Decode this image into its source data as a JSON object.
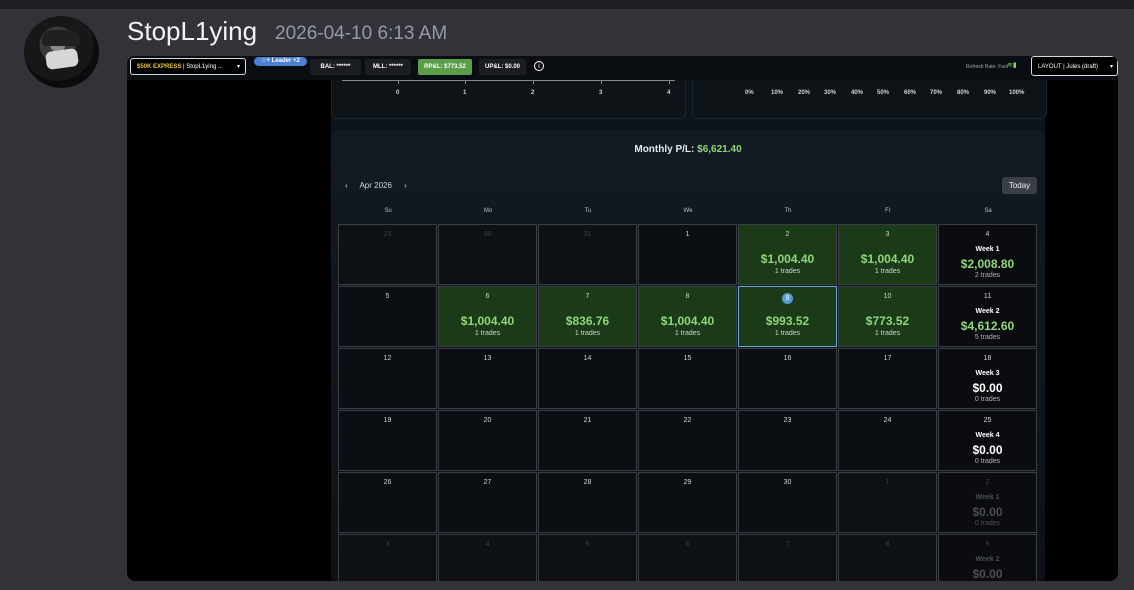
{
  "message": {
    "username": "StopL1ying",
    "timestamp": "2026-04-10 6:13 AM"
  },
  "toolbar": {
    "account_prefix": "$50K EXPRESS",
    "account_name": " | StopL1ying ...",
    "leader_badge": "☆+ Leader +2",
    "bal": "BAL: ******",
    "mll": "MLL: ******",
    "rpl": "RP&L: $773.52",
    "upl": "UP&L: $0.00",
    "info": "i",
    "refresh": "Refresh Rate: Fast",
    "layout": "LAYOUT | Jules (draft)"
  },
  "panels": {
    "left_ticks": [
      "0",
      "1",
      "2",
      "3",
      "4"
    ],
    "right_ticks": [
      "0%",
      "10%",
      "20%",
      "30%",
      "40%",
      "50%",
      "60%",
      "70%",
      "80%",
      "90%",
      "100%"
    ]
  },
  "calendar": {
    "title_label": "Monthly P/L: ",
    "title_value": "$6,621.40",
    "prev": "‹",
    "month": "Apr 2026",
    "next": "›",
    "today": "Today",
    "weekdays": [
      "Su",
      "Mo",
      "Tu",
      "We",
      "Th",
      "Fr",
      "Sa"
    ],
    "rows": [
      [
        {
          "day": "29",
          "dim": true
        },
        {
          "day": "30",
          "dim": true
        },
        {
          "day": "31",
          "dim": true
        },
        {
          "day": "1"
        },
        {
          "day": "2",
          "amount": "$1,004.40",
          "trades": "1 trades"
        },
        {
          "day": "3",
          "amount": "$1,004.40",
          "trades": "1 trades"
        },
        {
          "day": "4",
          "week": "Week 1",
          "week_amount": "$2,008.80",
          "week_trades": "2 trades",
          "positive": true
        }
      ],
      [
        {
          "day": "5"
        },
        {
          "day": "6",
          "amount": "$1,004.40",
          "trades": "1 trades"
        },
        {
          "day": "7",
          "amount": "$836.76",
          "trades": "1 trades"
        },
        {
          "day": "8",
          "amount": "$1,004.40",
          "trades": "1 trades"
        },
        {
          "day": "9",
          "amount": "$993.52",
          "trades": "1 trades",
          "selected": true
        },
        {
          "day": "10",
          "amount": "$773.52",
          "trades": "1 trades"
        },
        {
          "day": "11",
          "week": "Week 2",
          "week_amount": "$4,612.60",
          "week_trades": "5 trades",
          "positive": true
        }
      ],
      [
        {
          "day": "12"
        },
        {
          "day": "13"
        },
        {
          "day": "14"
        },
        {
          "day": "15"
        },
        {
          "day": "16"
        },
        {
          "day": "17"
        },
        {
          "day": "18",
          "week": "Week 3",
          "week_amount": "$0.00",
          "week_trades": "0 trades"
        }
      ],
      [
        {
          "day": "19"
        },
        {
          "day": "20"
        },
        {
          "day": "21"
        },
        {
          "day": "22"
        },
        {
          "day": "23"
        },
        {
          "day": "24"
        },
        {
          "day": "25",
          "week": "Week 4",
          "week_amount": "$0.00",
          "week_trades": "0 trades"
        }
      ],
      [
        {
          "day": "26"
        },
        {
          "day": "27"
        },
        {
          "day": "28"
        },
        {
          "day": "29"
        },
        {
          "day": "30"
        },
        {
          "day": "1",
          "dim": true
        },
        {
          "day": "2",
          "dim": true,
          "week": "Week 1",
          "week_amount": "$0.00",
          "week_trades": "0 trades"
        }
      ],
      [
        {
          "day": "3",
          "dim": true
        },
        {
          "day": "4",
          "dim": true
        },
        {
          "day": "5",
          "dim": true
        },
        {
          "day": "6",
          "dim": true
        },
        {
          "day": "7",
          "dim": true
        },
        {
          "day": "8",
          "dim": true
        },
        {
          "day": "9",
          "dim": true,
          "week": "Week 2",
          "week_amount": "$0.00",
          "week_trades": ""
        }
      ]
    ]
  }
}
